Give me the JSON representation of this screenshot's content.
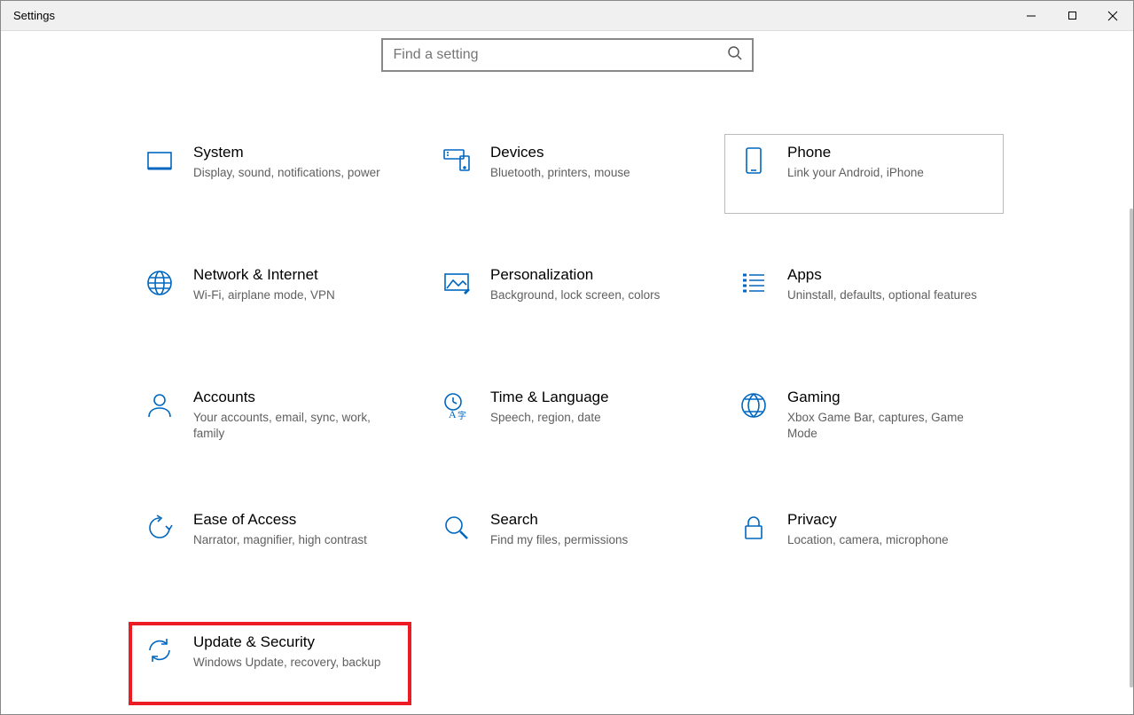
{
  "window": {
    "title": "Settings"
  },
  "search": {
    "placeholder": "Find a setting"
  },
  "tiles": [
    {
      "key": "system",
      "title": "System",
      "desc": "Display, sound, notifications, power"
    },
    {
      "key": "devices",
      "title": "Devices",
      "desc": "Bluetooth, printers, mouse"
    },
    {
      "key": "phone",
      "title": "Phone",
      "desc": "Link your Android, iPhone",
      "hover": true
    },
    {
      "key": "network",
      "title": "Network & Internet",
      "desc": "Wi-Fi, airplane mode, VPN"
    },
    {
      "key": "personalization",
      "title": "Personalization",
      "desc": "Background, lock screen, colors"
    },
    {
      "key": "apps",
      "title": "Apps",
      "desc": "Uninstall, defaults, optional features"
    },
    {
      "key": "accounts",
      "title": "Accounts",
      "desc": "Your accounts, email, sync, work, family"
    },
    {
      "key": "time",
      "title": "Time & Language",
      "desc": "Speech, region, date"
    },
    {
      "key": "gaming",
      "title": "Gaming",
      "desc": "Xbox Game Bar, captures, Game Mode"
    },
    {
      "key": "ease",
      "title": "Ease of Access",
      "desc": "Narrator, magnifier, high contrast"
    },
    {
      "key": "search",
      "title": "Search",
      "desc": "Find my files, permissions"
    },
    {
      "key": "privacy",
      "title": "Privacy",
      "desc": "Location, camera, microphone"
    },
    {
      "key": "update",
      "title": "Update & Security",
      "desc": "Windows Update, recovery, backup",
      "highlight": true
    }
  ]
}
